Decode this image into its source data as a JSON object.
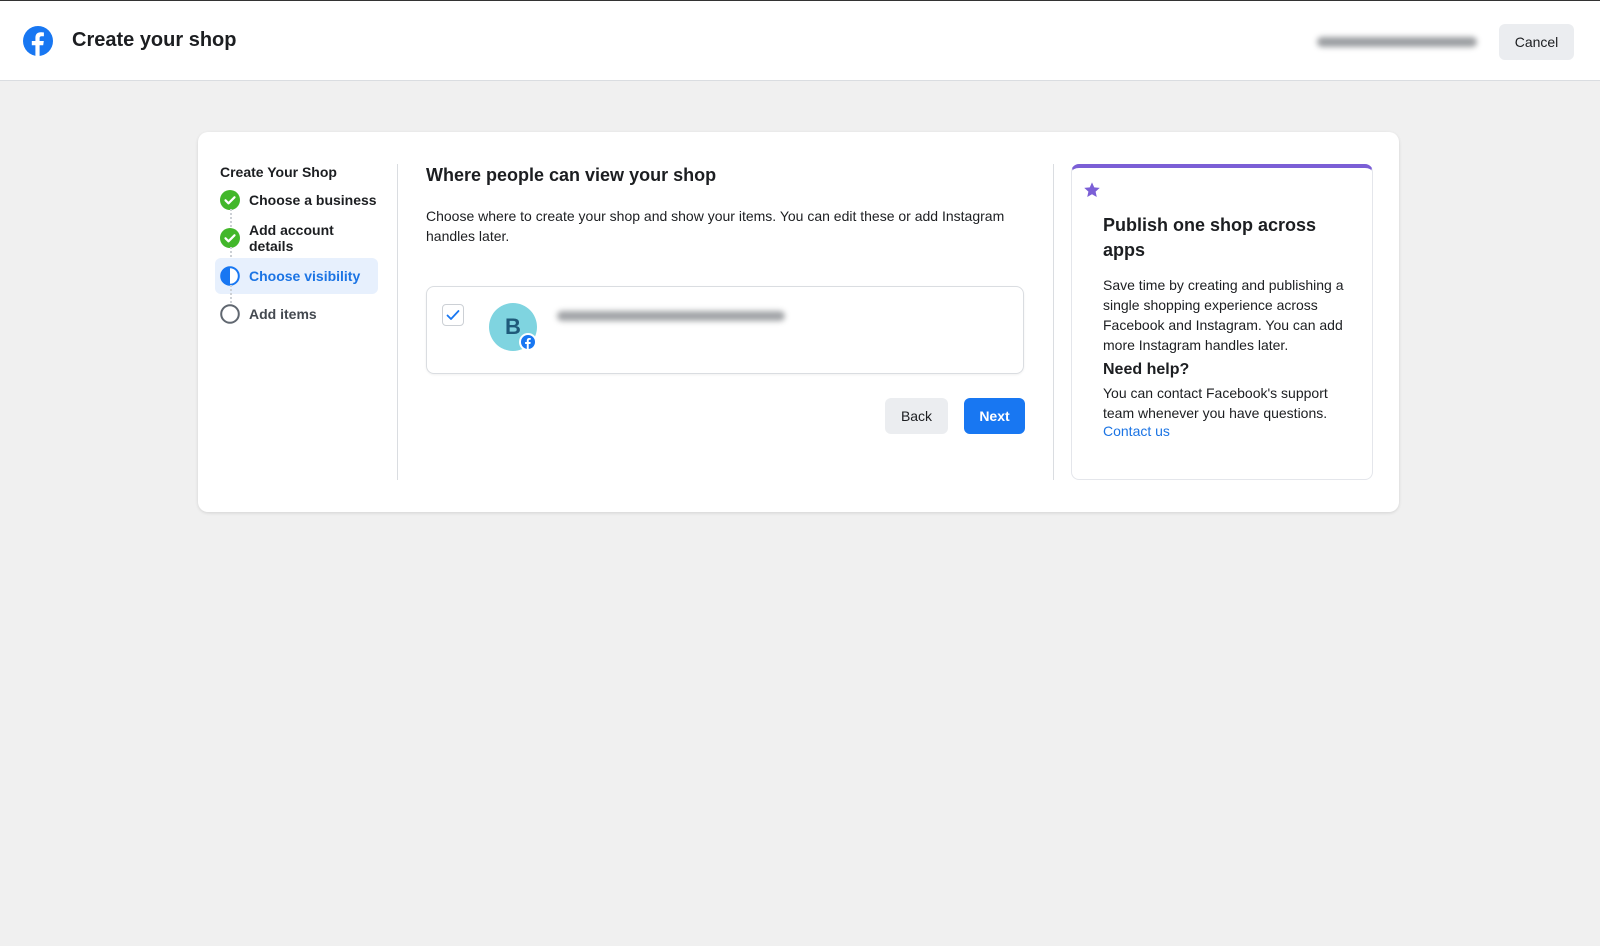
{
  "header": {
    "title": "Create your shop",
    "cancel_label": "Cancel"
  },
  "stepper": {
    "title": "Create Your Shop",
    "steps": [
      {
        "label": "Choose a business",
        "status": "complete"
      },
      {
        "label": "Add account details",
        "status": "complete"
      },
      {
        "label": "Choose visibility",
        "status": "active"
      },
      {
        "label": "Add items",
        "status": "pending"
      }
    ]
  },
  "main": {
    "title": "Where people can view your shop",
    "description": "Choose where to create your shop and show your items. You can edit these or add Instagram handles later.",
    "option": {
      "avatar_letter": "B",
      "checked": true
    },
    "back_label": "Back",
    "next_label": "Next"
  },
  "side_panel": {
    "title": "Publish one shop across apps",
    "text": "Save time by creating and publishing a single shopping experience across Facebook and Instagram. You can add more Instagram handles later.",
    "help_title": "Need help?",
    "help_text": "You can contact Facebook's support team whenever you have questions.",
    "contact_label": "Contact us"
  },
  "colors": {
    "brand_blue": "#1877f2",
    "success_green": "#42b72a",
    "accent_purple": "#7b5fd6"
  },
  "icons": [
    "facebook-logo-icon",
    "check-circle-icon",
    "half-circle-icon",
    "empty-circle-icon",
    "checkmark-icon",
    "star-icon"
  ]
}
